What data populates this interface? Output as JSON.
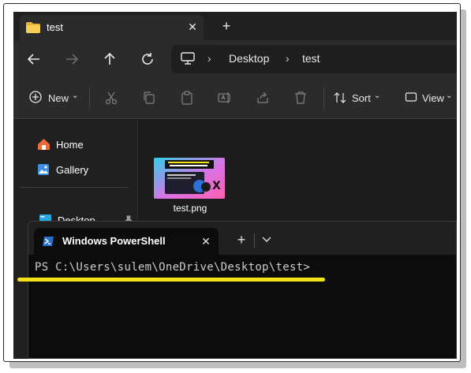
{
  "tab": {
    "title": "test",
    "close": "✕",
    "new_tab": "+"
  },
  "address": {
    "segments": [
      "Desktop",
      "test"
    ]
  },
  "commands": {
    "new_label": "New",
    "sort_label": "Sort",
    "view_label": "View"
  },
  "sidebar": {
    "items": [
      {
        "label": "Home",
        "icon": "home-icon"
      },
      {
        "label": "Gallery",
        "icon": "gallery-icon"
      },
      {
        "label": "Desktop",
        "icon": "desktop-icon",
        "pinned": true
      }
    ]
  },
  "files": [
    {
      "name": "test.png"
    }
  ],
  "thumbnail": {
    "headline": "POST LINKS WITH HEADING AND EXCERPT ON X",
    "glyph": "X"
  },
  "powershell": {
    "title": "Windows PowerShell",
    "close": "✕",
    "plus": "+",
    "prompt": "PS C:\\Users\\sulem\\OneDrive\\Desktop\\test>"
  },
  "colors": {
    "highlight": "#f5e31a",
    "folder": "#f0c040",
    "accent": "#4aa3ff"
  }
}
